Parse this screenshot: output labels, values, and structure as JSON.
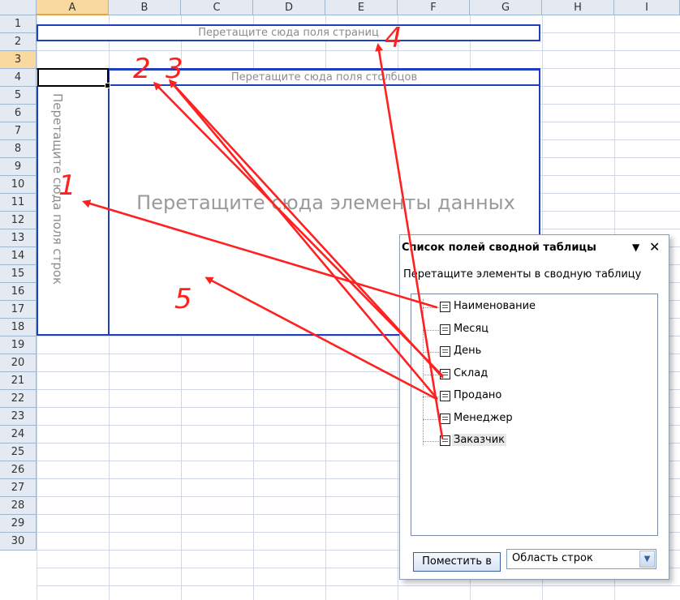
{
  "sheet": {
    "columns": [
      "A",
      "B",
      "C",
      "D",
      "E",
      "F",
      "G",
      "H",
      "I"
    ],
    "rows": [
      "1",
      "2",
      "3",
      "4",
      "5",
      "6",
      "7",
      "8",
      "9",
      "10",
      "11",
      "12",
      "13",
      "14",
      "15",
      "16",
      "17",
      "18",
      "19",
      "20",
      "21",
      "22",
      "23",
      "24",
      "25",
      "26",
      "27",
      "28",
      "29",
      "30"
    ]
  },
  "pivot": {
    "page_drop": "Перетащите сюда поля страниц",
    "column_drop": "Перетащите сюда поля столбцов",
    "row_drop": "Перетащите сюда поля строк",
    "data_drop": "Перетащите сюда элементы данных"
  },
  "panel": {
    "title": "Список полей сводной таблицы",
    "menu_icon": "▼",
    "close_icon": "✕",
    "hint": "Перетащите элементы в сводную таблицу",
    "fields": [
      "Наименование",
      "Месяц",
      "День",
      "Склад",
      "Продано",
      "Менеджер",
      "Заказчик"
    ],
    "selected_field": "Заказчик",
    "place_button": "Поместить в",
    "area_select": "Область строк",
    "dropdown_icon": "chevron-down-icon"
  },
  "annotations": {
    "numbers": [
      "1",
      "2",
      "3",
      "4",
      "5"
    ],
    "color": "#ff2020"
  }
}
